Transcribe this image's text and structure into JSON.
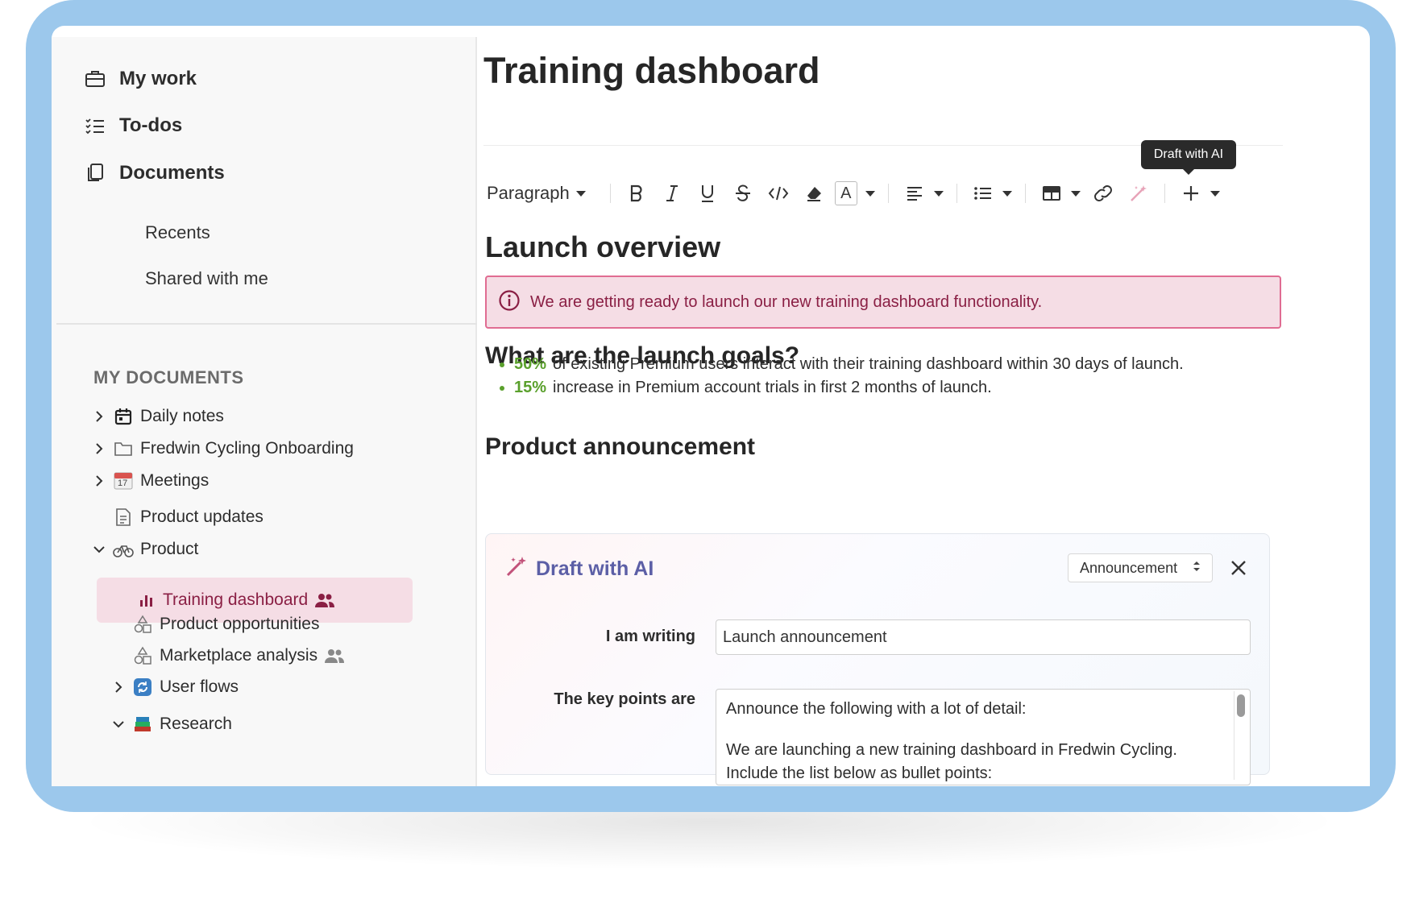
{
  "sidebar": {
    "nav": [
      {
        "label": "My work",
        "icon": "briefcase-icon"
      },
      {
        "label": "To-dos",
        "icon": "checklist-icon"
      },
      {
        "label": "Documents",
        "icon": "documents-icon"
      }
    ],
    "documents_sub": [
      "Recents",
      "Shared with me"
    ],
    "section_title": "MY DOCUMENTS",
    "tree": [
      {
        "label": "Daily notes",
        "icon": "calendar-icon"
      },
      {
        "label": "Fredwin Cycling Onboarding",
        "icon": "folder-icon"
      },
      {
        "label": "Meetings",
        "icon": "calendar-date-icon",
        "icon_text": "17"
      },
      {
        "label": "Product updates",
        "icon": "document-icon"
      },
      {
        "label": "Product",
        "icon": "bicycle-icon"
      },
      {
        "label": "Training dashboard",
        "icon": "bar-chart-icon",
        "shared": true
      },
      {
        "label": "Product opportunities",
        "icon": "shapes-icon"
      },
      {
        "label": "Marketplace analysis",
        "icon": "shapes-icon",
        "shared": true
      },
      {
        "label": "User flows",
        "icon": "refresh-icon"
      },
      {
        "label": "Research",
        "icon": "books-icon"
      }
    ]
  },
  "page": {
    "title": "Training dashboard",
    "tooltip": "Draft with AI",
    "toolbar": {
      "paragraph": "Paragraph",
      "text_color_glyph": "A"
    },
    "h_overview": "Launch overview",
    "callout": "We are getting ready to launch our new training dashboard functionality.",
    "h_goals": "What are the launch goals?",
    "goals": [
      {
        "pct": "50%",
        "text": "of existing Premium users interact with their training dashboard within 30 days of launch."
      },
      {
        "pct": "15%",
        "text": "increase in Premium account trials in first 2 months of launch."
      }
    ],
    "h_announcement": "Product announcement"
  },
  "ai": {
    "title": "Draft with AI",
    "select_value": "Announcement",
    "writing_label": "I am writing",
    "writing_value": "Launch announcement",
    "keypoints_label": "The key points are",
    "keypoints_lines": [
      "Announce the following with a lot of detail:",
      "",
      "We are launching a new training dashboard in Fredwin Cycling.",
      "Include the list below as bullet points:"
    ]
  },
  "colors": {
    "frame": "#9cc8ec",
    "accent_pink": "#e06c92",
    "green": "#5aa02c",
    "ai_purple": "#5c5fa6",
    "active_bg": "#f5dde5"
  }
}
